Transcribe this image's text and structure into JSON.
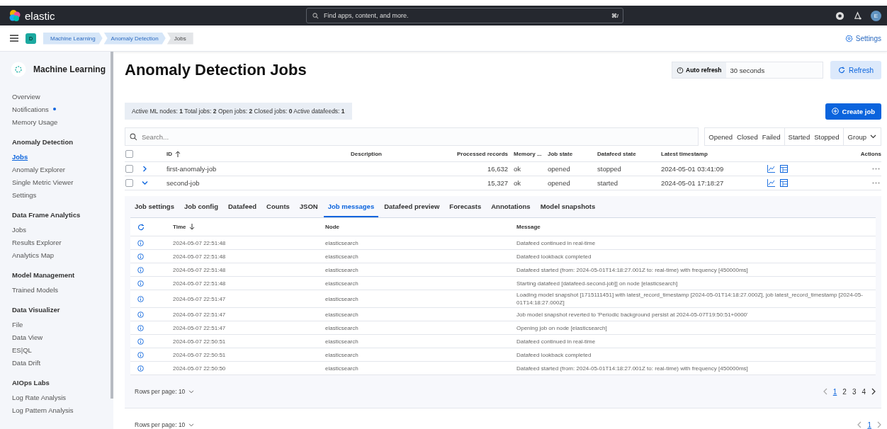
{
  "header": {
    "logo_text": "elastic",
    "search_placeholder": "Find apps, content, and more.",
    "search_shortcut": "⌘/",
    "avatar_initial": "E"
  },
  "breadcrumb_bar": {
    "space_initial": "D",
    "breadcrumbs": [
      {
        "label": "Machine Learning",
        "current": false
      },
      {
        "label": "Anomaly Detection",
        "current": false
      },
      {
        "label": "Jobs",
        "current": true
      }
    ],
    "settings_link": "Settings"
  },
  "sidebar": {
    "title": "Machine Learning",
    "sections": [
      {
        "items": [
          {
            "label": "Overview",
            "selected": false,
            "dot": false
          },
          {
            "label": "Notifications",
            "selected": false,
            "dot": true
          },
          {
            "label": "Memory Usage",
            "selected": false,
            "dot": false
          }
        ]
      },
      {
        "heading": "Anomaly Detection",
        "items": [
          {
            "label": "Jobs",
            "selected": true,
            "dot": false
          },
          {
            "label": "Anomaly Explorer",
            "selected": false,
            "dot": false
          },
          {
            "label": "Single Metric Viewer",
            "selected": false,
            "dot": false
          },
          {
            "label": "Settings",
            "selected": false,
            "dot": false
          }
        ]
      },
      {
        "heading": "Data Frame Analytics",
        "items": [
          {
            "label": "Jobs",
            "selected": false,
            "dot": false
          },
          {
            "label": "Results Explorer",
            "selected": false,
            "dot": false
          },
          {
            "label": "Analytics Map",
            "selected": false,
            "dot": false
          }
        ]
      },
      {
        "heading": "Model Management",
        "items": [
          {
            "label": "Trained Models",
            "selected": false,
            "dot": false
          }
        ]
      },
      {
        "heading": "Data Visualizer",
        "items": [
          {
            "label": "File",
            "selected": false,
            "dot": false
          },
          {
            "label": "Data View",
            "selected": false,
            "dot": false
          },
          {
            "label": "ES|QL",
            "selected": false,
            "dot": false
          },
          {
            "label": "Data Drift",
            "selected": false,
            "dot": false
          }
        ]
      },
      {
        "heading": "AIOps Labs",
        "items": [
          {
            "label": "Log Rate Analysis",
            "selected": false,
            "dot": false
          },
          {
            "label": "Log Pattern Analysis",
            "selected": false,
            "dot": false
          }
        ]
      }
    ]
  },
  "page": {
    "title": "Anomaly Detection Jobs",
    "auto_refresh_label": "Auto refresh",
    "auto_refresh_value": "30 seconds",
    "refresh_button": "Refresh",
    "stats": "Active ML nodes: **1** Total jobs: **2** Open jobs: **2** Closed jobs: **0** Active datafeeds: **1**",
    "create_button": "Create job",
    "search_placeholder": "Search...",
    "filter_groups": [
      [
        "Opened",
        "Closed",
        "Failed"
      ],
      [
        "Started",
        "Stopped"
      ]
    ],
    "group_filter": "Group"
  },
  "jobs_table": {
    "header_checked": false,
    "columns": [
      {
        "label": "ID",
        "sorted": true,
        "ascending": true
      },
      {
        "label": "Description"
      },
      {
        "label": "Processed records"
      },
      {
        "label": "Memory ..."
      },
      {
        "label": "Job state"
      },
      {
        "label": "Datafeed state"
      },
      {
        "label": "Latest timestamp"
      },
      {
        "label": "Actions"
      }
    ],
    "rows": [
      {
        "checked": false,
        "expanded": false,
        "id": "first-anomaly-job",
        "processed_records": "16,632",
        "memory": "ok",
        "job_state": "opened",
        "datafeed_state": "stopped",
        "latest_timestamp": "2024-05-01 03:41:09"
      },
      {
        "checked": false,
        "expanded": true,
        "id": "second-job",
        "processed_records": "15,327",
        "memory": "ok",
        "job_state": "opened",
        "datafeed_state": "started",
        "latest_timestamp": "2024-05-01 17:18:27"
      }
    ]
  },
  "detail_tabs": [
    {
      "label": "Job settings",
      "selected": false
    },
    {
      "label": "Job config",
      "selected": false
    },
    {
      "label": "Datafeed",
      "selected": false
    },
    {
      "label": "Counts",
      "selected": false
    },
    {
      "label": "JSON",
      "selected": false
    },
    {
      "label": "Job messages",
      "selected": true
    },
    {
      "label": "Datafeed preview",
      "selected": false
    },
    {
      "label": "Forecasts",
      "selected": false
    },
    {
      "label": "Annotations",
      "selected": false
    },
    {
      "label": "Model snapshots",
      "selected": false
    }
  ],
  "messages_table": {
    "columns": [
      {
        "label": "Time",
        "sorted": true,
        "ascending": false
      },
      {
        "label": "Node"
      },
      {
        "label": "Message"
      }
    ],
    "rows": [
      {
        "time": "2024-05-07 22:51:48",
        "node": "elasticsearch",
        "message": "Datafeed continued in real-time"
      },
      {
        "time": "2024-05-07 22:51:48",
        "node": "elasticsearch",
        "message": "Datafeed lookback completed"
      },
      {
        "time": "2024-05-07 22:51:48",
        "node": "elasticsearch",
        "message": "Datafeed started (from: 2024-05-01T14:18:27.001Z to: real-time) with frequency [450000ms]"
      },
      {
        "time": "2024-05-07 22:51:48",
        "node": "elasticsearch",
        "message": "Starting datafeed [datafeed-second-job]] on node [elasticsearch]"
      },
      {
        "time": "2024-05-07 22:51:47",
        "node": "elasticsearch",
        "message": "Loading model snapshot [1715111451] with latest_record_timestamp [2024-05-01T14:18:27.000Z], job latest_record_timestamp [2024-05-01T14:18:27.000Z]"
      },
      {
        "time": "2024-05-07 22:51:47",
        "node": "elasticsearch",
        "message": "Job model snapshot reverted to 'Periodic background persist at 2024-05-07T19:50:51+0000'"
      },
      {
        "time": "2024-05-07 22:51:47",
        "node": "elasticsearch",
        "message": "Opening job on node [elasticsearch]"
      },
      {
        "time": "2024-05-07 22:50:51",
        "node": "elasticsearch",
        "message": "Datafeed continued in real-time"
      },
      {
        "time": "2024-05-07 22:50:51",
        "node": "elasticsearch",
        "message": "Datafeed lookback completed"
      },
      {
        "time": "2024-05-07 22:50:50",
        "node": "elasticsearch",
        "message": "Datafeed started (from: 2024-05-01T14:18:27.001Z to: real-time) with frequency [450000ms]"
      }
    ],
    "rows_per_page": "Rows per page: 10",
    "pages": [
      {
        "label": "1",
        "selected": true
      },
      {
        "label": "2",
        "selected": false
      },
      {
        "label": "3",
        "selected": false
      },
      {
        "label": "4",
        "selected": false
      }
    ]
  },
  "jobs_pagination": {
    "rows_per_page": "Rows per page: 10",
    "pages": [
      {
        "label": "1",
        "selected": true
      }
    ]
  }
}
